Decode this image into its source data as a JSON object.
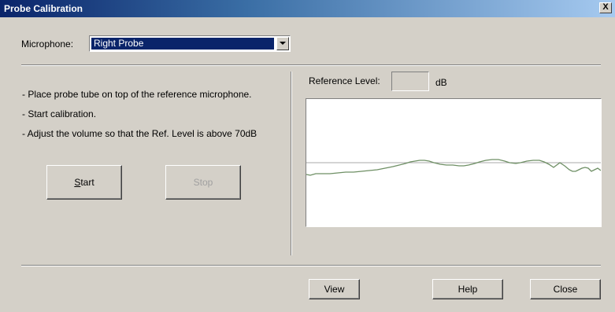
{
  "window": {
    "title": "Probe Calibration",
    "close_glyph": "X"
  },
  "microphone": {
    "label": "Microphone:",
    "selected": "Right Probe"
  },
  "instructions": [
    "- Place probe tube on top of the reference microphone.",
    "- Start calibration.",
    "- Adjust the volume so that the Ref. Level is above 70dB"
  ],
  "buttons": {
    "start": {
      "mnemonic": "S",
      "rest": "tart"
    },
    "stop": "Stop",
    "view": "View",
    "help": "Help",
    "close": "Close"
  },
  "reference": {
    "label": "Reference Level:",
    "value": "",
    "unit": "dB"
  },
  "colors": {
    "title_bar": "#0a246a",
    "selection": "#0a246a",
    "trace": "#6e8f64",
    "threshold": "#a8a8a8",
    "face": "#d4d0c8"
  }
}
